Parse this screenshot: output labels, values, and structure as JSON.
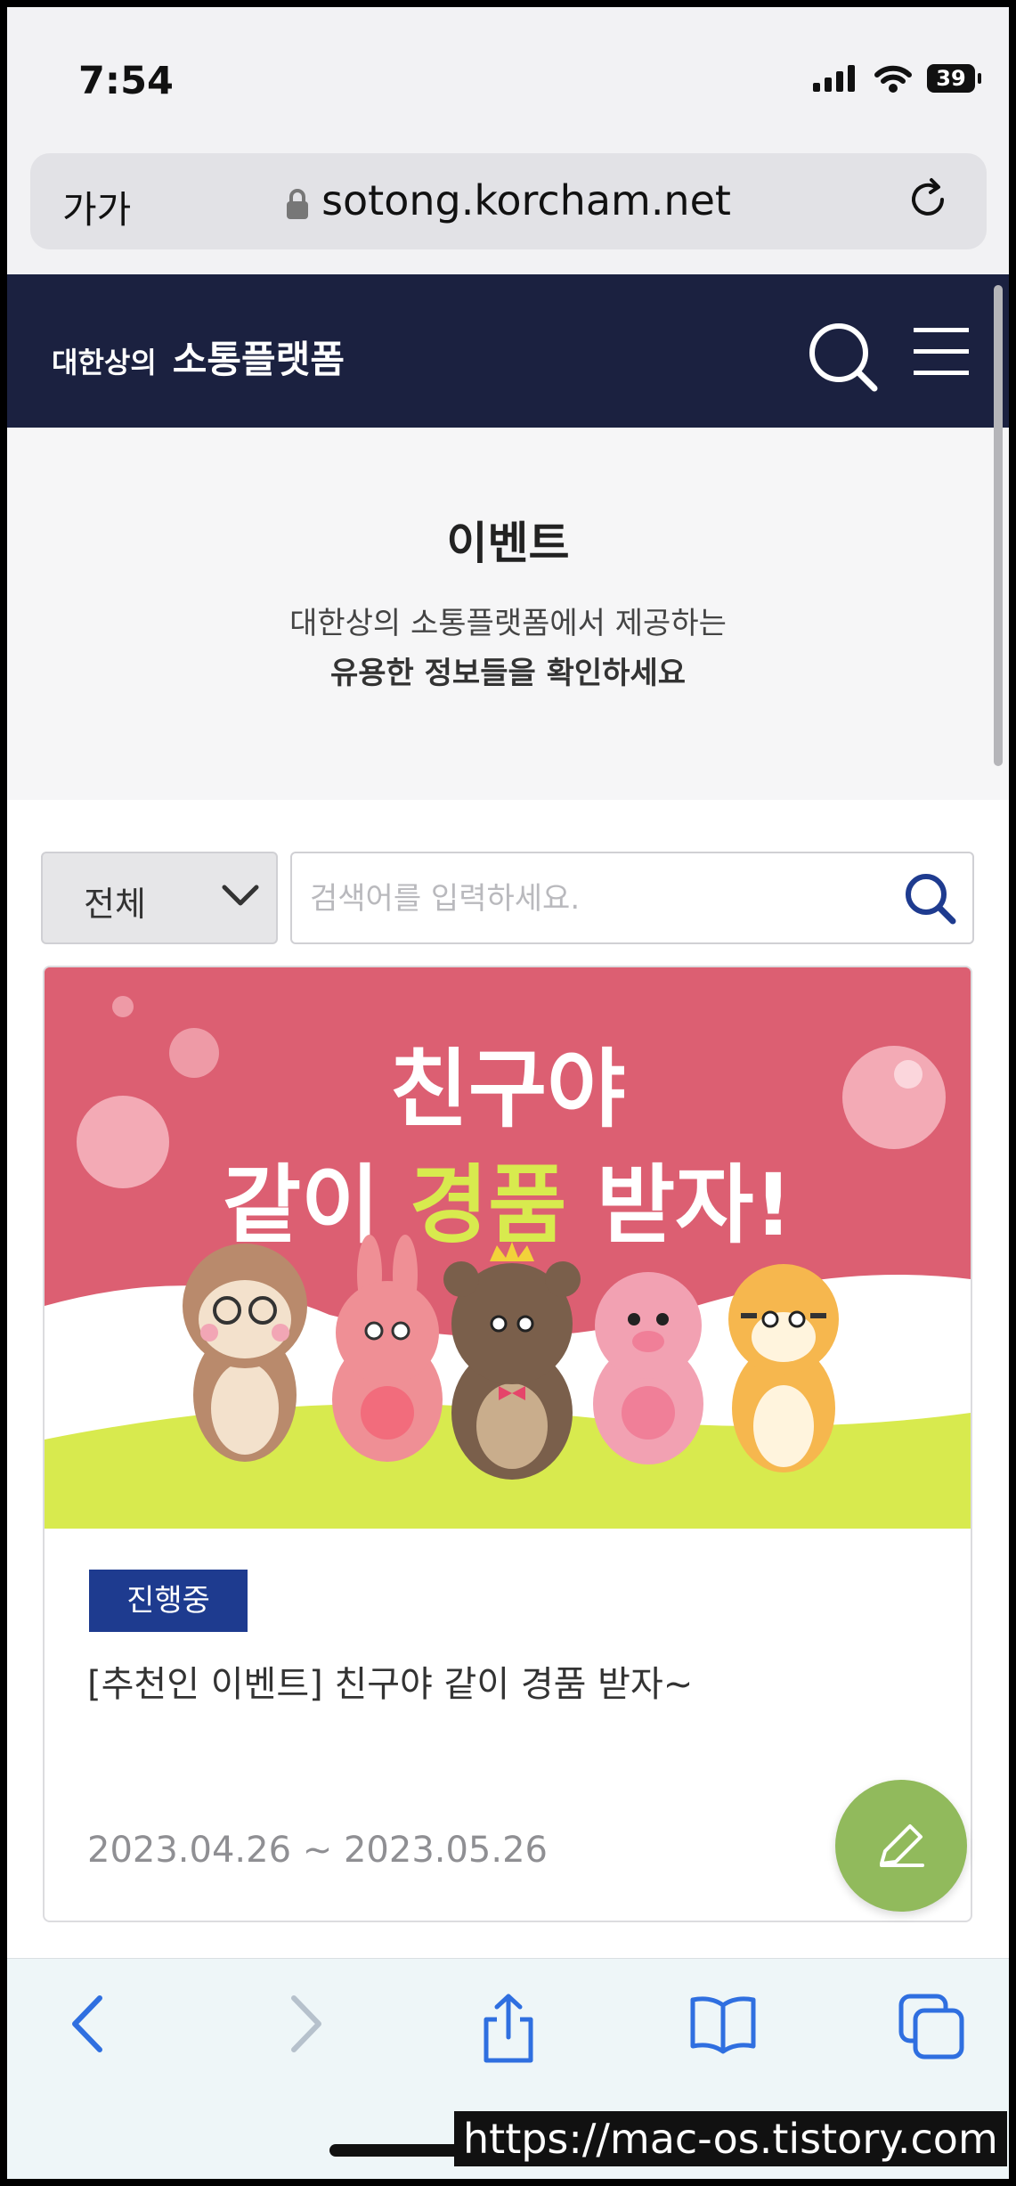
{
  "status": {
    "time": "7:54",
    "battery": "39"
  },
  "browser": {
    "aa": "가가",
    "url": "sotong.korcham.net"
  },
  "header": {
    "logo_small": "대한상의",
    "logo_big": "소통플랫폼"
  },
  "hero": {
    "title": "이벤트",
    "sub1": "대한상의 소통플랫폼에서 제공하는",
    "sub2": "유용한 정보들을 확인하세요"
  },
  "filter": {
    "selected": "전체",
    "placeholder": "검색어를 입력하세요."
  },
  "event": {
    "banner_line1": "친구야",
    "banner_line2a": "같이 ",
    "banner_line2b": "경품",
    "banner_line2c": " 받자!",
    "status": "진행중",
    "title": "[추천인 이벤트] 친구야 같이 경품 받자~",
    "period": "2023.04.26 ~ 2023.05.26"
  },
  "watermark": "https://mac-os.tistory.com",
  "colors": {
    "header_bg": "#1b2140",
    "badge": "#1e3b8f",
    "banner_bg": "#dc5f72",
    "fab": "#91ba5c",
    "accent_yellow": "#d8ea4e"
  }
}
